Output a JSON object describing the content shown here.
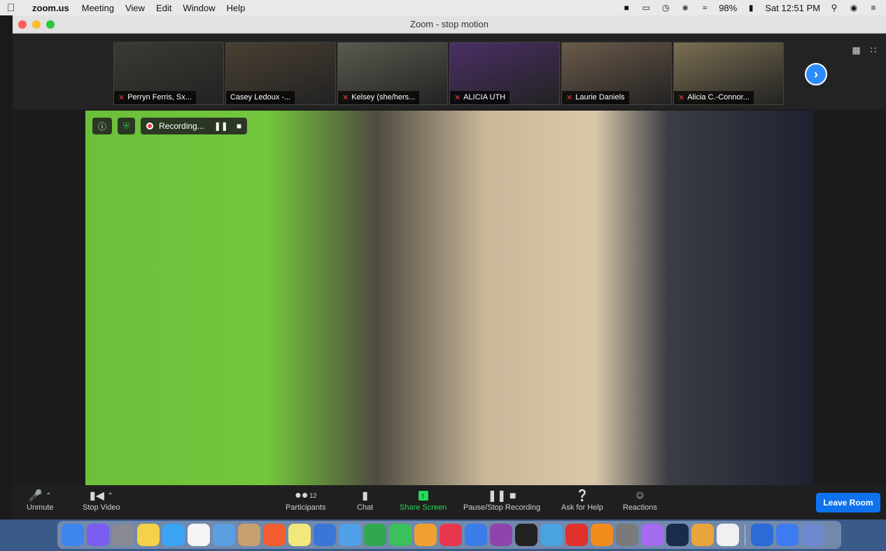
{
  "menubar": {
    "app": "zoom.us",
    "items": [
      "Meeting",
      "View",
      "Edit",
      "Window",
      "Help"
    ],
    "battery": "98%",
    "clock": "Sat 12:51 PM"
  },
  "window": {
    "title": "Zoom - stop motion"
  },
  "participants_strip": [
    {
      "name": "Perryn Ferris, Sx...",
      "muted": true,
      "bg": "#3b3a33"
    },
    {
      "name": "Casey Ledoux -...",
      "muted": false,
      "bg": "#4a4033"
    },
    {
      "name": "Kelsey (she/hers...",
      "muted": true,
      "bg": "#5b5a4f"
    },
    {
      "name": "ALICIA UTH",
      "muted": true,
      "bg": "#4b2f66"
    },
    {
      "name": "Laurie Daniels",
      "muted": true,
      "bg": "#6b5a4a"
    },
    {
      "name": "Alicia C.-Connor...",
      "muted": true,
      "bg": "#7a6f52"
    }
  ],
  "recording": {
    "label": "Recording..."
  },
  "toolbar": {
    "unmute": "Unmute",
    "stop_video": "Stop Video",
    "participants": "Participants",
    "participants_count": "12",
    "chat": "Chat",
    "share_screen": "Share Screen",
    "pause_stop": "Pause/Stop Recording",
    "ask_help": "Ask for Help",
    "reactions": "Reactions",
    "leave": "Leave Room"
  },
  "dock_colors": [
    "#3d86f0",
    "#7b5cf0",
    "#8a8a95",
    "#f3d24a",
    "#3ba4f5",
    "#f4f4f4",
    "#5aa0e0",
    "#c7a070",
    "#f25c2e",
    "#f2e77a",
    "#3a76d8",
    "#4fa0e8",
    "#2fa84f",
    "#3cc15a",
    "#f0a030",
    "#e8364f",
    "#3a7de8",
    "#8e44ad",
    "#222222",
    "#4aa3df",
    "#e0312c",
    "#f28c1d",
    "#7a7a7a",
    "#a56cf0",
    "#1b2b4a",
    "#e9a53b",
    "#f0f0f0",
    "#2b6bd8",
    "#3d7cf0",
    "#6d8ad0"
  ]
}
